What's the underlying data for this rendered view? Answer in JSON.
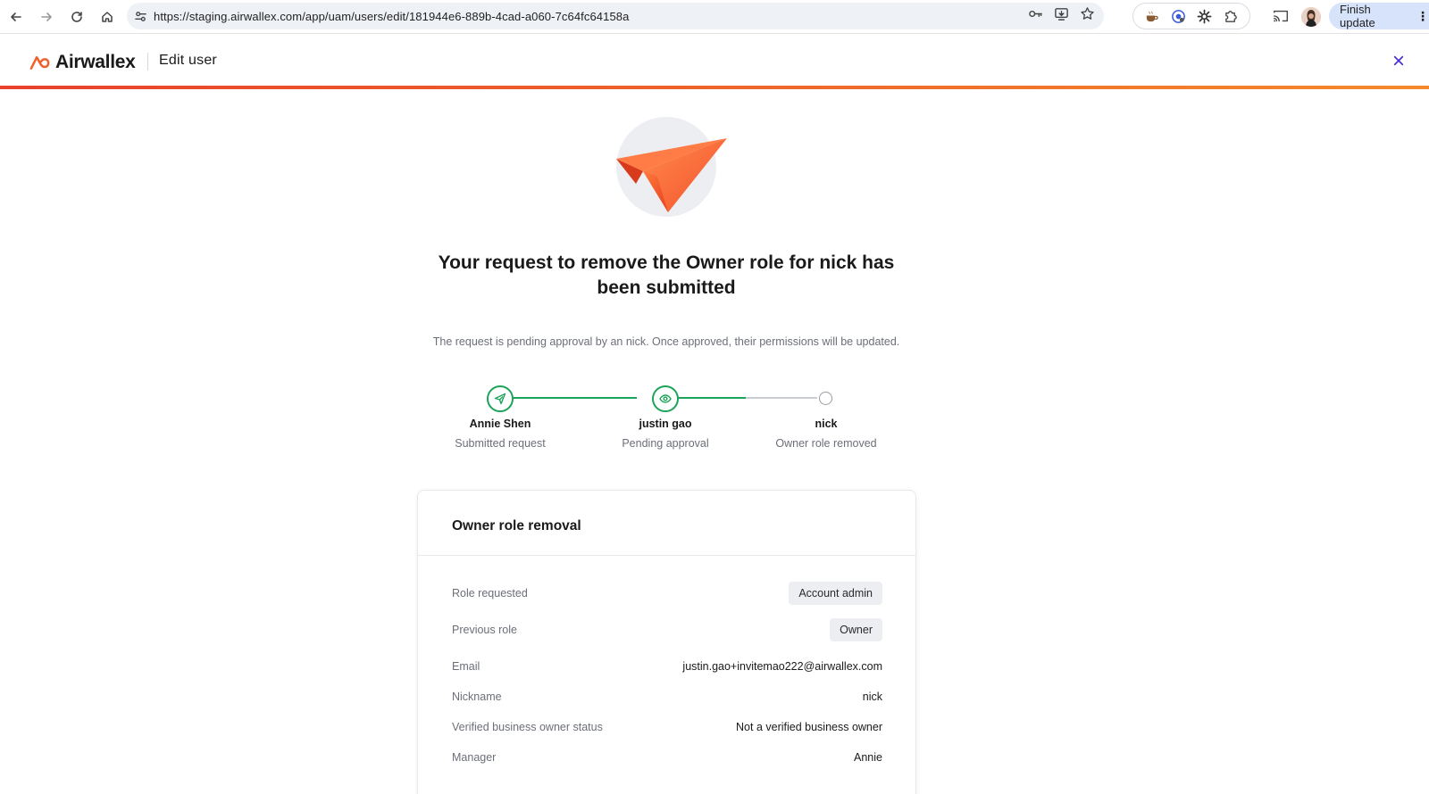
{
  "browser": {
    "url": "https://staging.airwallex.com/app/uam/users/edit/181944e6-889b-4cad-a060-7c64fc64158a",
    "finish_update_label": "Finish update",
    "menu_glyph": "⋮"
  },
  "header": {
    "logo_text": "Airwallex",
    "title": "Edit user",
    "close_glyph": "✕"
  },
  "colors": {
    "brand_orange": "#f0602b",
    "success_green": "#1ea35a",
    "close_purple": "#4b30d8"
  },
  "confirmation": {
    "headline": "Your request to remove the Owner role for nick has been submitted",
    "subtext": "The request is pending approval by an nick. Once approved, their permissions will be updated."
  },
  "stepper": {
    "steps": [
      {
        "name": "Annie Shen",
        "status": "Submitted request",
        "icon": "paper-plane-icon",
        "state": "complete"
      },
      {
        "name": "justin gao",
        "status": "Pending approval",
        "icon": "eye-icon",
        "state": "current"
      },
      {
        "name": "nick",
        "status": "Owner role removed",
        "icon": "empty-circle-icon",
        "state": "pending"
      }
    ]
  },
  "card": {
    "title": "Owner role removal",
    "rows": [
      {
        "label": "Role requested",
        "value": "Account admin",
        "style": "pill"
      },
      {
        "label": "Previous role",
        "value": "Owner",
        "style": "pill"
      },
      {
        "label": "Email",
        "value": "justin.gao+invitemao222@airwallex.com",
        "style": "text"
      },
      {
        "label": "Nickname",
        "value": "nick",
        "style": "text"
      },
      {
        "label": "Verified business owner status",
        "value": "Not a verified business owner",
        "style": "text"
      },
      {
        "label": "Manager",
        "value": "Annie",
        "style": "text"
      }
    ]
  }
}
